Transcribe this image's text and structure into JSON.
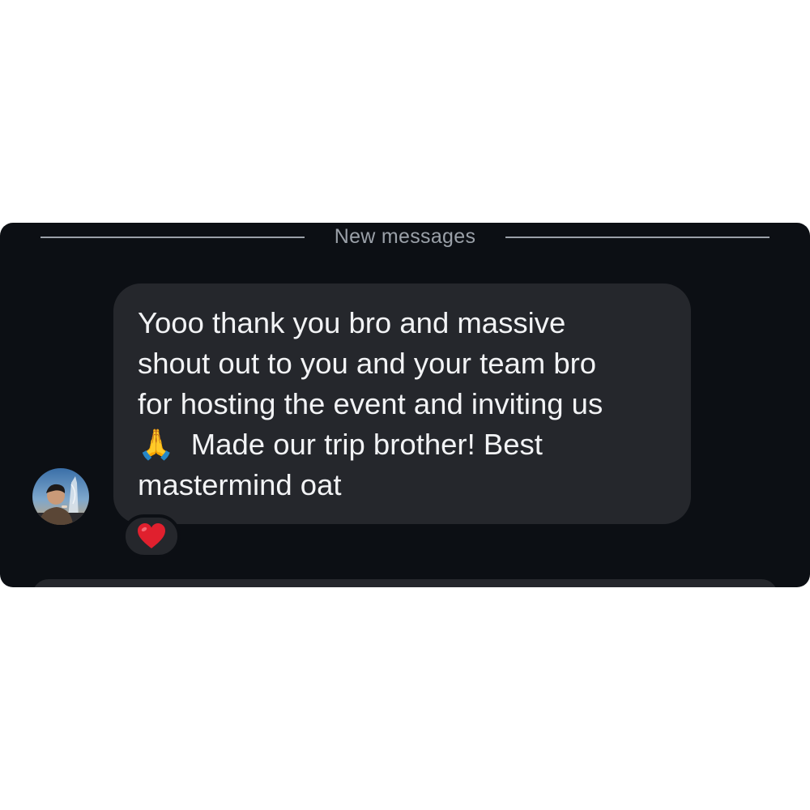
{
  "chat": {
    "divider_label": "New messages",
    "message": {
      "line_1": "Yooo thank you bro and massive",
      "line_2": "shout out to you and your team bro",
      "line_3": "for hosting the event and inviting us",
      "line_4_emoji": "🙏",
      "line_4_text": "Made our trip brother! Best",
      "line_5": "mastermind oat"
    },
    "reaction": {
      "icon": "red-heart-icon",
      "color": "#e0202e"
    },
    "avatar": {
      "icon": "user-avatar"
    }
  },
  "colors": {
    "page_background": "#ffffff",
    "panel_background": "#0c0f14",
    "bubble_background": "#25272c",
    "message_text": "#f2f3f5",
    "divider": "#9aa0a8"
  }
}
